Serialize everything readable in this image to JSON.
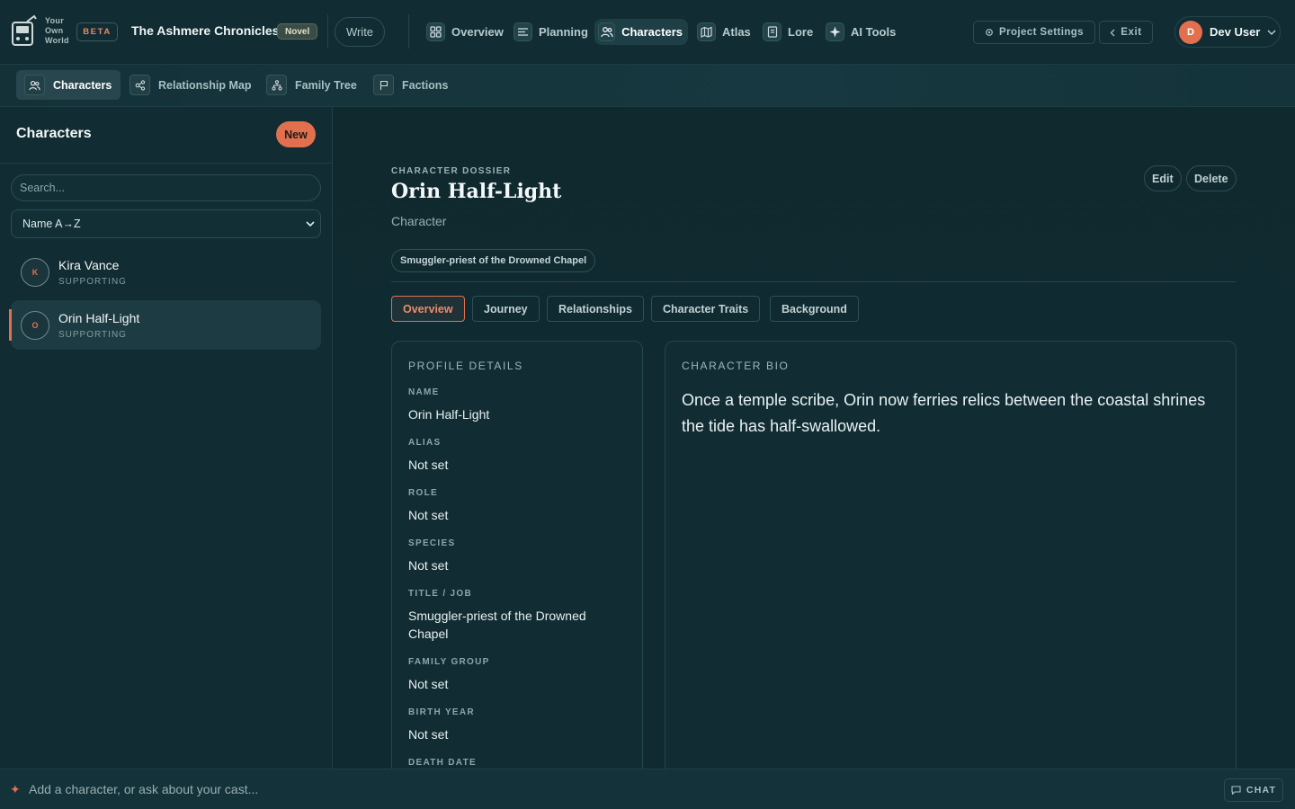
{
  "app": {
    "logo_text": [
      "Your",
      "Own",
      "World"
    ],
    "beta_label": "BETA",
    "project_title": "The Ashmere Chronicles",
    "project_type": "Novel",
    "write_label": "Write"
  },
  "nav": {
    "items": [
      {
        "label": "Overview",
        "icon": "grid-icon"
      },
      {
        "label": "Planning",
        "icon": "list-icon"
      },
      {
        "label": "Characters",
        "icon": "people-icon",
        "active": true
      },
      {
        "label": "Atlas",
        "icon": "map-icon"
      },
      {
        "label": "Lore",
        "icon": "book-icon"
      },
      {
        "label": "AI Tools",
        "icon": "sparkle-icon"
      }
    ],
    "settings_label": "Project Settings",
    "exit_label": "Exit",
    "user_initial": "D",
    "user_name": "Dev User"
  },
  "subnav": {
    "items": [
      {
        "label": "Characters",
        "icon": "people-icon",
        "active": true
      },
      {
        "label": "Relationship Map",
        "icon": "network-icon"
      },
      {
        "label": "Family Tree",
        "icon": "tree-icon"
      },
      {
        "label": "Factions",
        "icon": "flag-icon"
      }
    ]
  },
  "sidebar": {
    "title": "Characters",
    "new_label": "New",
    "search_placeholder": "Search...",
    "sort_value": "Name A→Z",
    "characters": [
      {
        "initial": "K",
        "name": "Kira Vance",
        "role": "SUPPORTING",
        "selected": false
      },
      {
        "initial": "O",
        "name": "Orin Half-Light",
        "role": "SUPPORTING",
        "selected": true
      }
    ]
  },
  "dossier": {
    "label": "CHARACTER DOSSIER",
    "name": "Orin Half-Light",
    "type": "Character",
    "edit_label": "Edit",
    "delete_label": "Delete",
    "chip": "Smuggler-priest of the Drowned Chapel",
    "tabs": [
      "Overview",
      "Journey",
      "Relationships",
      "Character Traits",
      "Background"
    ],
    "active_tab": "Overview"
  },
  "profile": {
    "title": "PROFILE DETAILS",
    "fields": [
      {
        "label": "NAME",
        "value": "Orin Half-Light"
      },
      {
        "label": "ALIAS",
        "value": "Not set"
      },
      {
        "label": "ROLE",
        "value": "Not set"
      },
      {
        "label": "SPECIES",
        "value": "Not set"
      },
      {
        "label": "TITLE / JOB",
        "value": "Smuggler-priest of the Drowned Chapel"
      },
      {
        "label": "FAMILY GROUP",
        "value": "Not set"
      },
      {
        "label": "BIRTH YEAR",
        "value": "Not set"
      },
      {
        "label": "DEATH DATE",
        "value": ""
      }
    ]
  },
  "bio": {
    "title": "CHARACTER BIO",
    "text": "Once a temple scribe, Orin now ferries relics between the coastal shrines the tide has half-swallowed."
  },
  "bottom": {
    "prompt": "Add a character, or ask about your cast...",
    "chat_label": "CHAT"
  },
  "colors": {
    "accent": "#e2704f",
    "background": "#0f2a30",
    "panel": "#112d33"
  }
}
